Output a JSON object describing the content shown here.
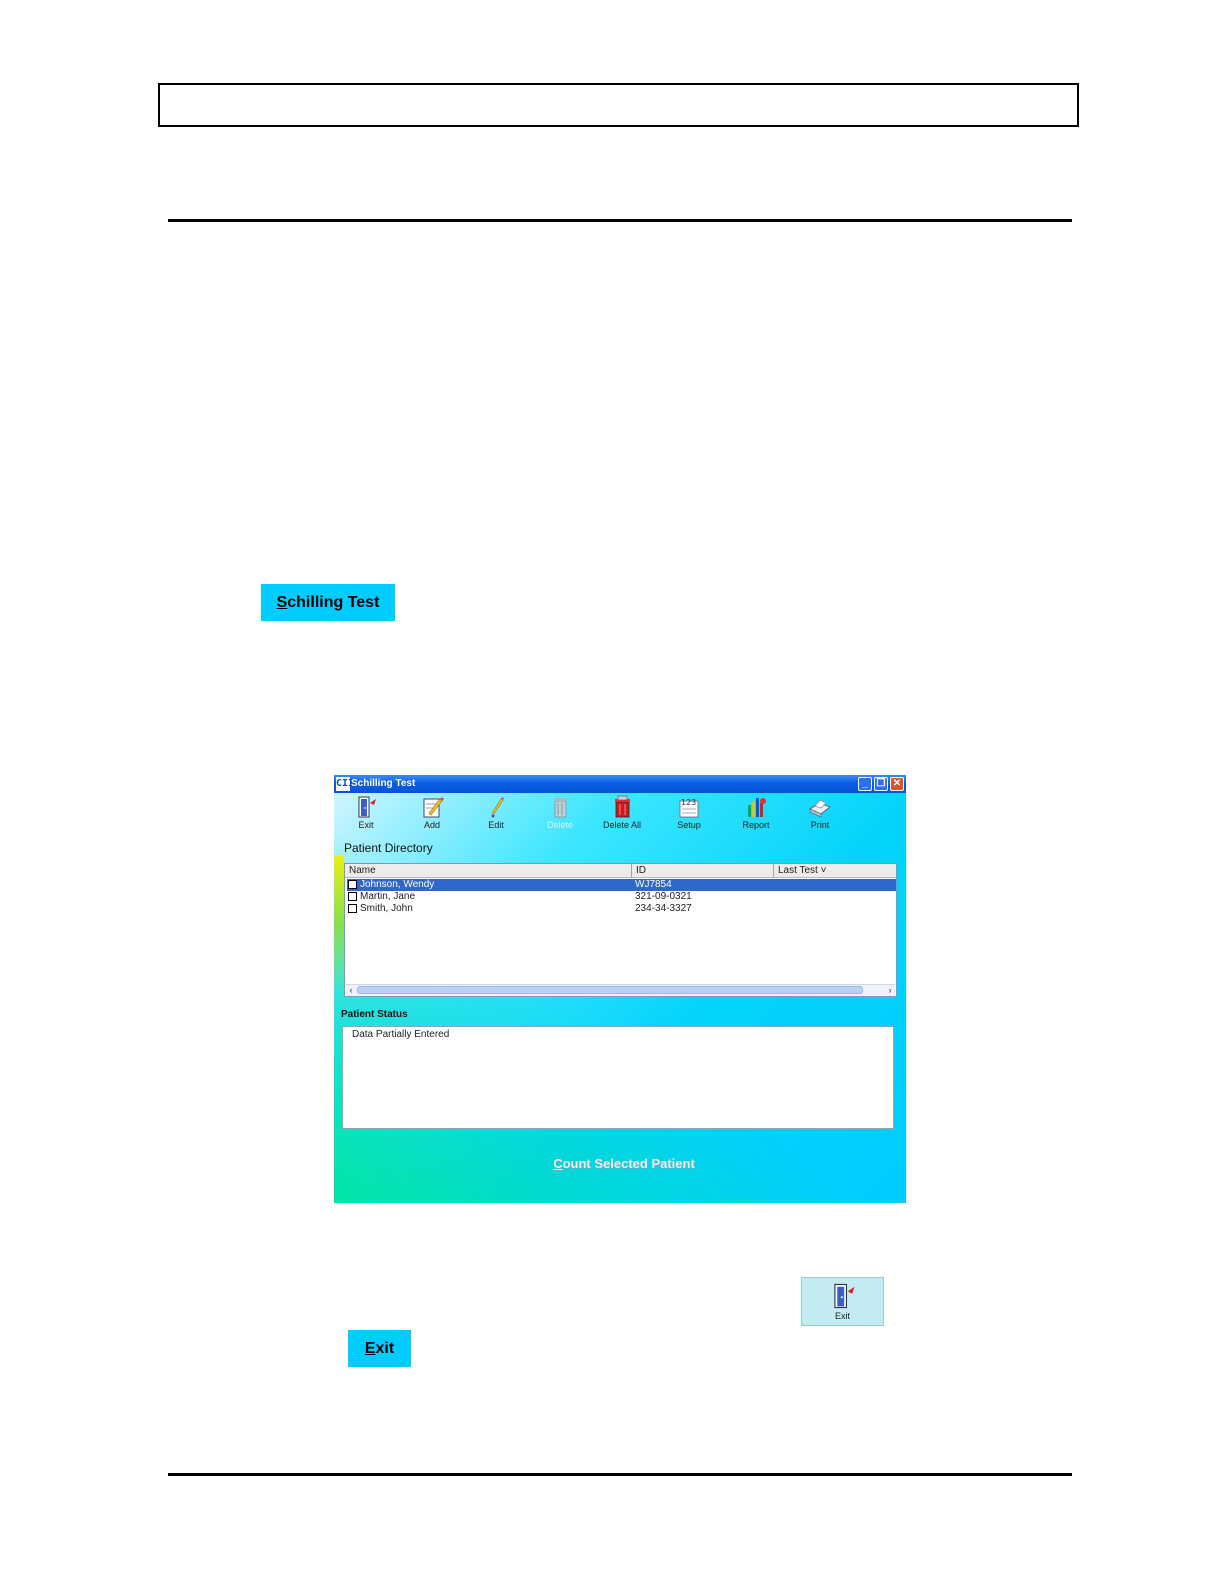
{
  "buttons": {
    "schilling_test": {
      "first": "S",
      "rest": "chilling Test"
    },
    "exit": {
      "first": "E",
      "rest": "xit"
    }
  },
  "window": {
    "title_logo": "CII",
    "title": "Schilling Test",
    "controls": {
      "minimize": "_",
      "restore": "❐",
      "close": "✕"
    },
    "toolbar": [
      {
        "label": "Exit",
        "icon": "exit-door-icon"
      },
      {
        "label": "Add",
        "icon": "add-pencil-icon"
      },
      {
        "label": "Edit",
        "icon": "edit-pencil-icon"
      },
      {
        "label": "Delete",
        "icon": "delete-trash-icon",
        "disabled": true
      },
      {
        "label": "Delete All",
        "icon": "delete-all-trash-icon"
      },
      {
        "label": "Setup",
        "icon": "setup-icon"
      },
      {
        "label": "Report",
        "icon": "report-chart-icon"
      },
      {
        "label": "Print",
        "icon": "print-icon"
      }
    ],
    "directory_label": "Patient Directory",
    "columns": [
      "Name",
      "ID",
      "Last Test ˅"
    ],
    "patients": [
      {
        "name": "Johnson, Wendy",
        "id": "WJ7854",
        "selected": true
      },
      {
        "name": "Martin, Jane",
        "id": "321-09-0321",
        "selected": false
      },
      {
        "name": "Smith, John",
        "id": "234-34-3327",
        "selected": false
      }
    ],
    "status_label": "Patient Status",
    "status_text": "Data Partially Entered",
    "count_button": {
      "first": "C",
      "rest": "ount Selected Patient"
    },
    "scroll_left": "‹",
    "scroll_right": "›"
  },
  "exit_icon_button": {
    "label": "Exit"
  },
  "colors": {
    "accent": "#00ccff",
    "selection": "#3167cc",
    "titlebar": "#0a5ee2"
  }
}
